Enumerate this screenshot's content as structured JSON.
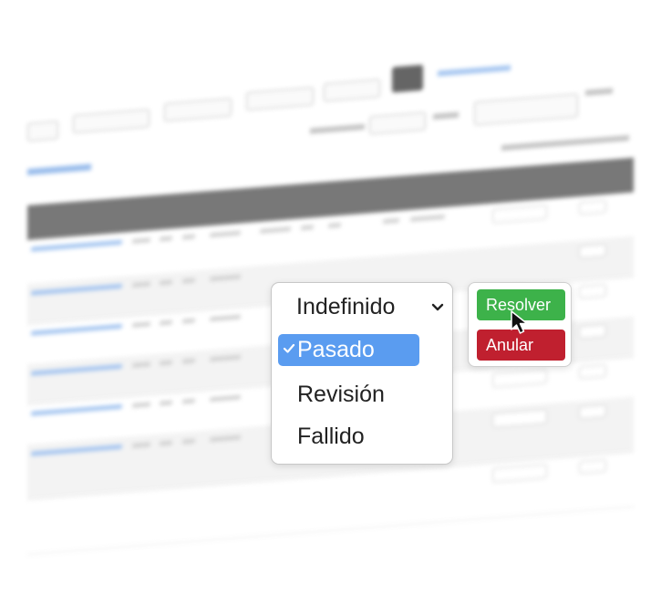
{
  "dropdown": {
    "current": "Indefinido",
    "options": [
      {
        "label": "Pasado",
        "selected": true
      },
      {
        "label": "Revisión",
        "selected": false
      },
      {
        "label": "Fallido",
        "selected": false
      }
    ]
  },
  "actions": {
    "resolve_label": "Resolver",
    "cancel_label": "Anular"
  },
  "colors": {
    "selected_option": "#5a9cf0",
    "resolve_button": "#3db24a",
    "cancel_button": "#c0202f"
  },
  "icons": [
    "chevron-down-icon",
    "check-icon",
    "mouse-pointer-icon"
  ]
}
